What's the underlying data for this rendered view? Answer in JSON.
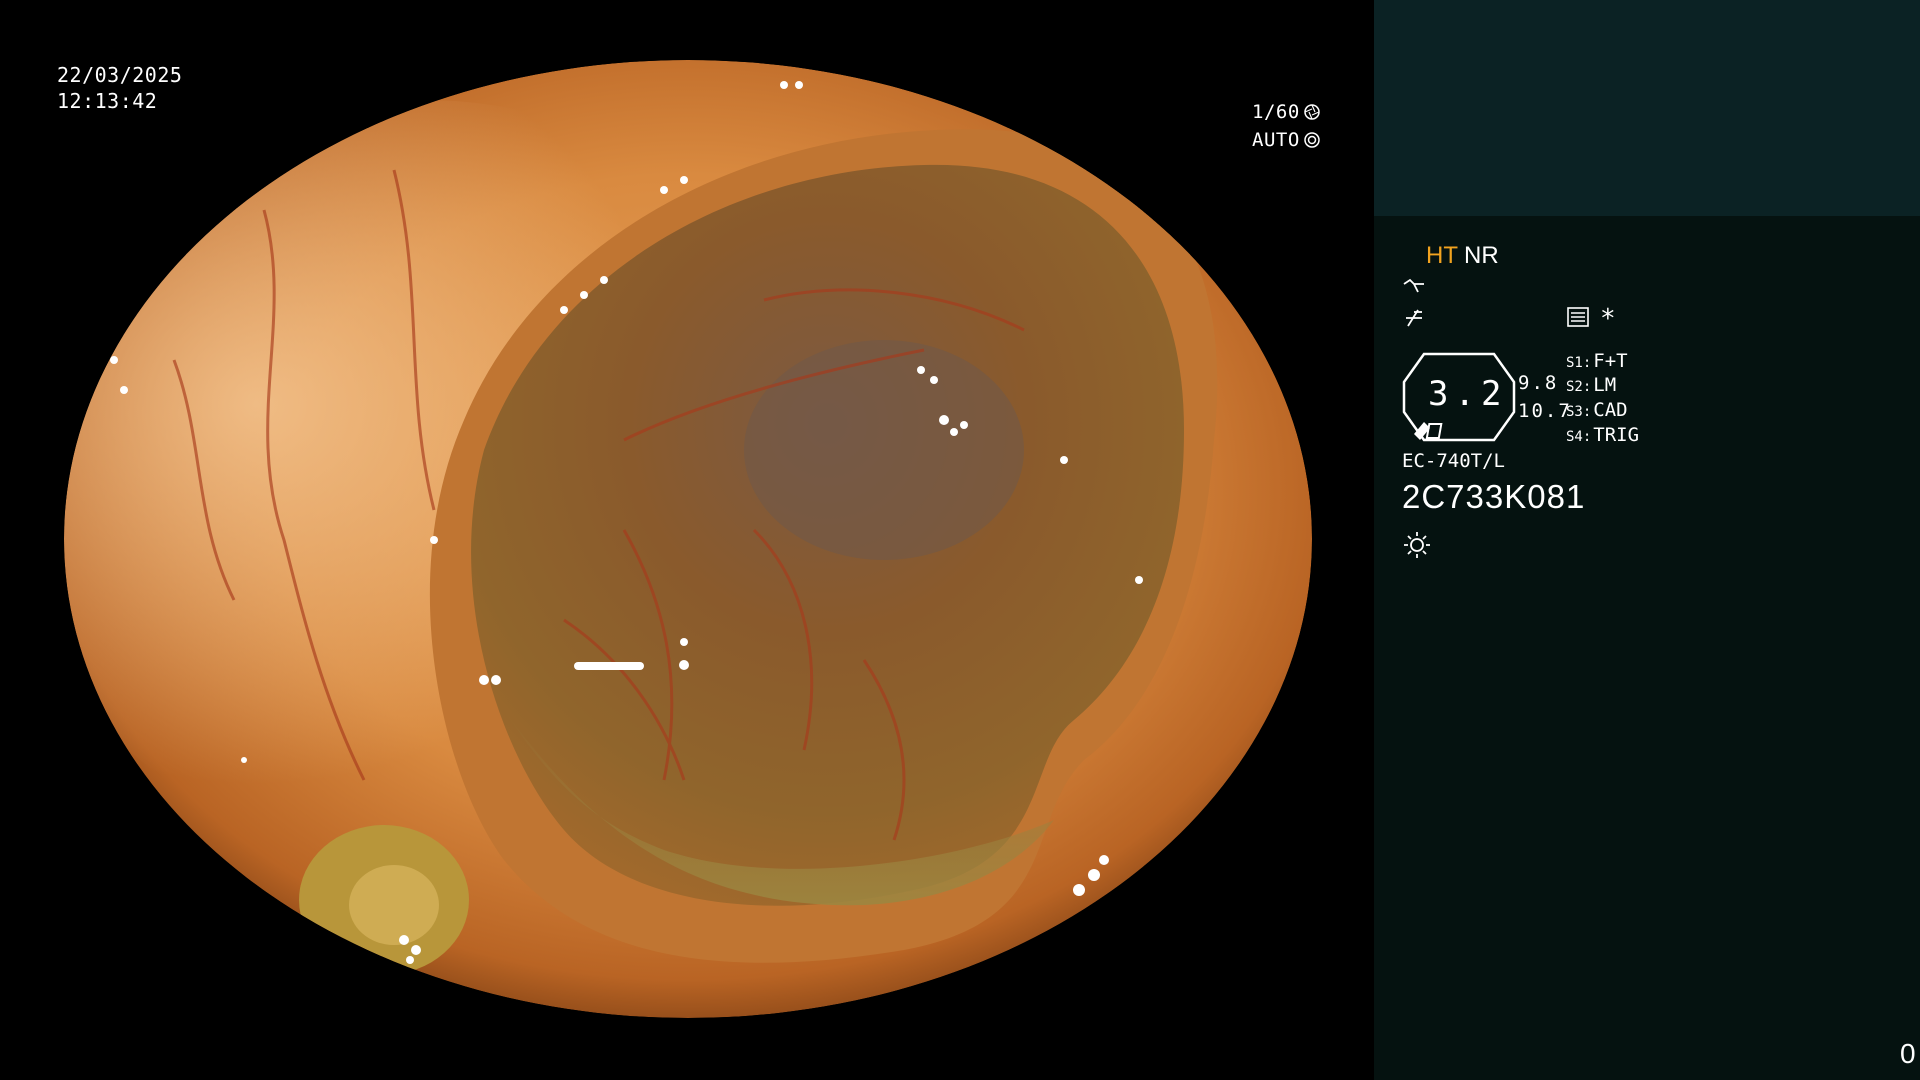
{
  "image": {
    "datetime": {
      "date": "22/03/2025",
      "time": "12:13:42"
    },
    "shutter": "1/60",
    "shutter_icon": "aperture-icon",
    "exposure": "AUTO",
    "exposure_icon": "iris-icon"
  },
  "panel": {
    "mode_ht": "HT",
    "mode_nr": "NR",
    "icons": [
      "scope-tip-icon",
      "enhancement-icon",
      "menu-list-icon",
      "light-icon"
    ],
    "star": "*",
    "zoom": "3.2",
    "value_1": "9.8",
    "value_2": "10.7",
    "switches": [
      {
        "key": "S1:",
        "value": "F+T"
      },
      {
        "key": "S2:",
        "value": "LM"
      },
      {
        "key": "S3:",
        "value": "CAD"
      },
      {
        "key": "S4:",
        "value": "TRIG"
      }
    ],
    "model": "EC-740T/L",
    "serial": "2C733K081",
    "counter": "0"
  },
  "colors": {
    "ht_accent": "#f2a31f",
    "panel_top": "#0b2224",
    "panel_body": "#051210",
    "mucosa": "#d98a40"
  }
}
